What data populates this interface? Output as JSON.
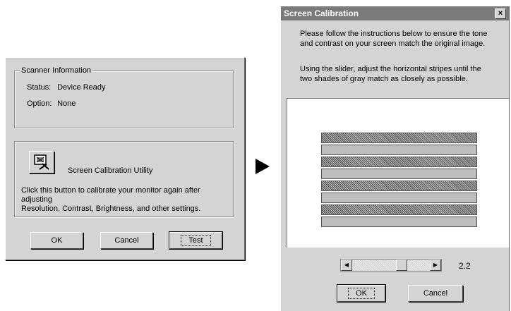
{
  "left_dialog": {
    "scanner_group_title": "Scanner Information",
    "status_label": "Status:",
    "status_value": "Device Ready",
    "option_label": "Option:",
    "option_value": "None",
    "utility_label": "Screen Calibration Utility",
    "utility_desc_line1": "Click this button to calibrate your monitor again after adjusting",
    "utility_desc_line2": "Resolution, Contrast, Brightness, and other settings.",
    "ok_label": "OK",
    "cancel_label": "Cancel",
    "test_label": "Test"
  },
  "right_dialog": {
    "title": "Screen Calibration",
    "close_glyph": "×",
    "instruction1_line1": "Please follow the instructions below to ensure the tone",
    "instruction1_line2": "and contrast on your screen match the original image.",
    "instruction2_line1": "Using the slider, adjust the horizontal stripes until the",
    "instruction2_line2": "two shades of gray match as closely as possible.",
    "slider_value": "2.2",
    "ok_label": "OK",
    "cancel_label": "Cancel",
    "stripe_pattern": [
      "hatch",
      "solid",
      "hatch",
      "solid",
      "hatch",
      "solid",
      "hatch",
      "solid"
    ]
  },
  "icons": {
    "arrow": "right-arrow-icon",
    "utility": "monitor-calibration-icon",
    "scroll_left": "scroll-left-icon",
    "scroll_right": "scroll-right-icon"
  }
}
